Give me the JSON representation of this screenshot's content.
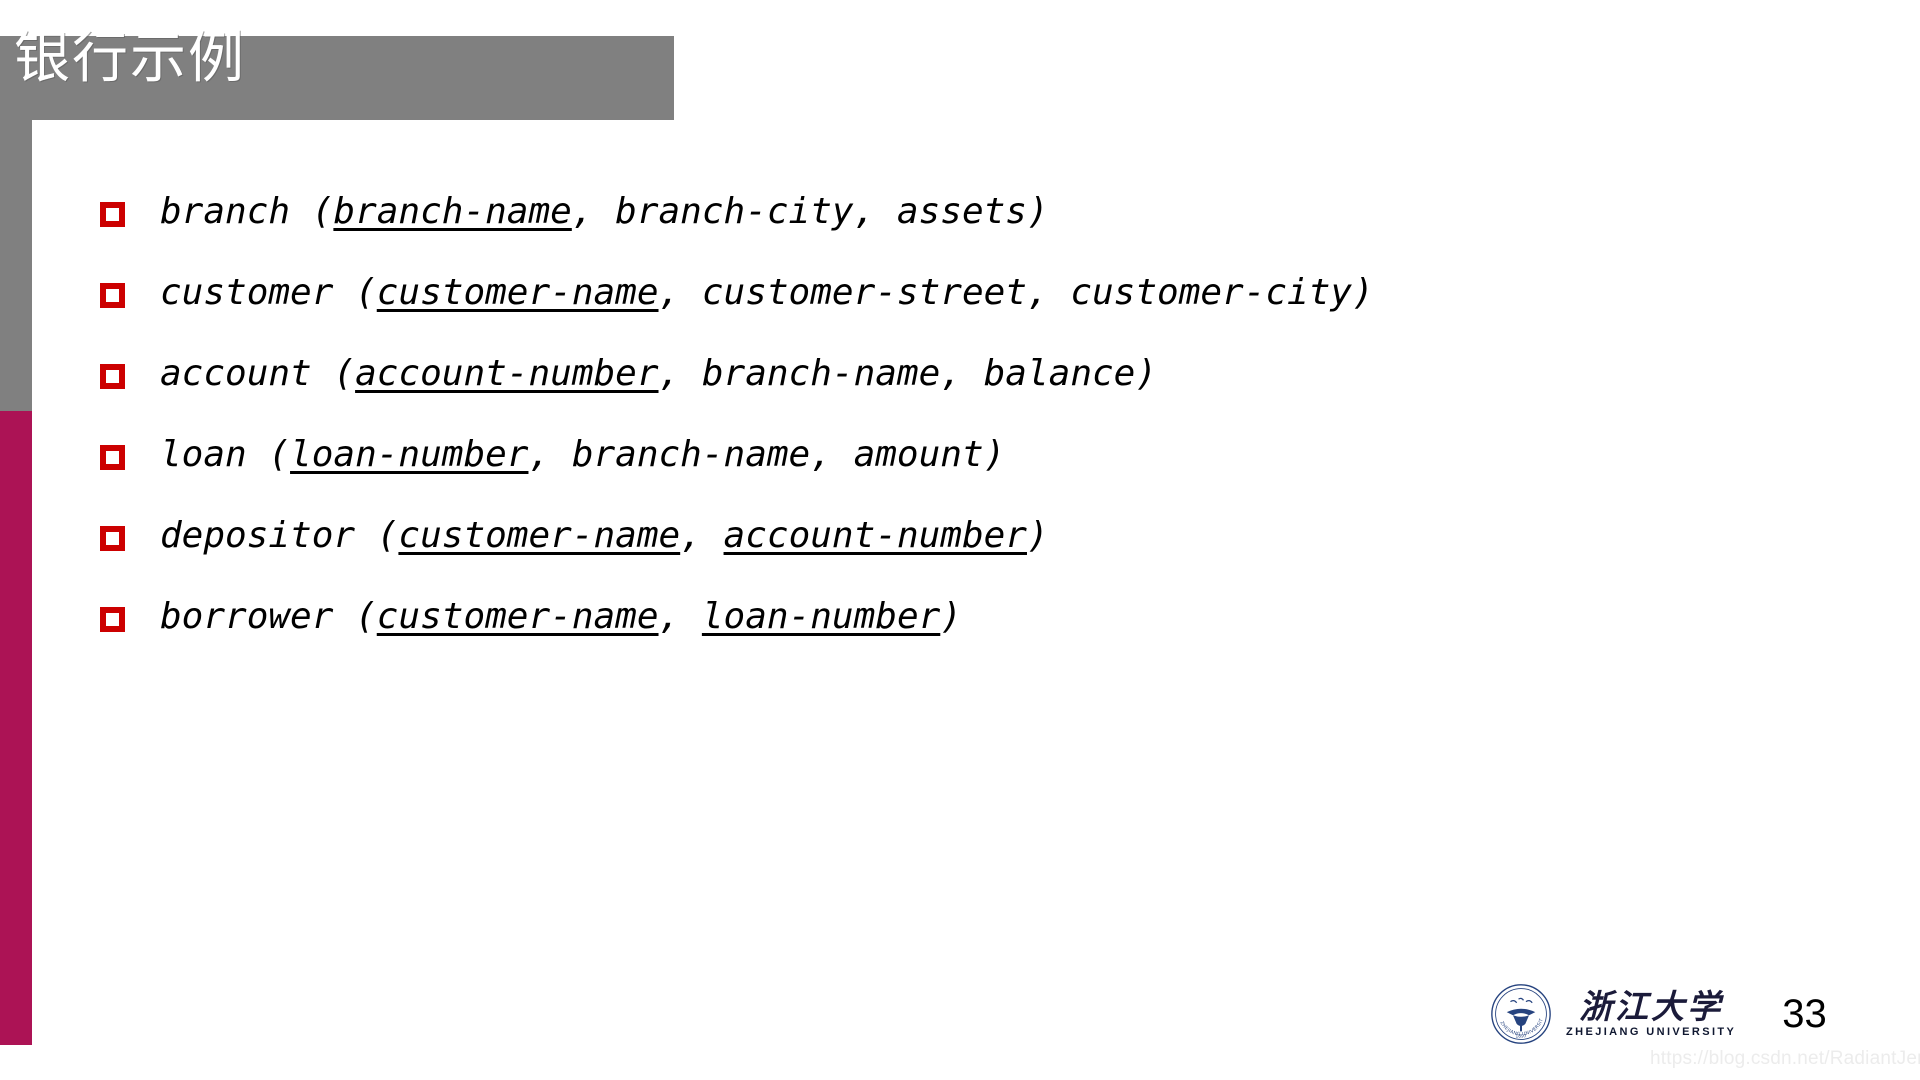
{
  "slide": {
    "title": "银行示例",
    "page_number": "33",
    "colors": {
      "banner_gray": "#808080",
      "accent_crimson": "#ac1355",
      "bullet_red": "#cc0000",
      "title_text": "#ffffff",
      "body_text": "#000000",
      "logo_blue": "#26437f",
      "watermark_gray": "#ececec"
    }
  },
  "bullets": [
    {
      "marker": "red-hollow-square-bullet",
      "relation": "branch",
      "full_text": "branch (branch-name, branch-city, assets)",
      "parts": [
        {
          "text": "branch (",
          "underline": false
        },
        {
          "text": "branch-name",
          "underline": true
        },
        {
          "text": ", branch-city, assets)",
          "underline": false
        }
      ]
    },
    {
      "marker": "red-hollow-square-bullet",
      "relation": "customer",
      "full_text": "customer (customer-name, customer-street, customer-city)",
      "parts": [
        {
          "text": "customer (",
          "underline": false
        },
        {
          "text": "customer-name",
          "underline": true
        },
        {
          "text": ", customer-street, customer-city)",
          "underline": false
        }
      ]
    },
    {
      "marker": "red-hollow-square-bullet",
      "relation": "account",
      "full_text": "account (account-number, branch-name, balance)",
      "parts": [
        {
          "text": "account (",
          "underline": false
        },
        {
          "text": "account-number",
          "underline": true
        },
        {
          "text": ", branch-name, balance)",
          "underline": false
        }
      ]
    },
    {
      "marker": "red-hollow-square-bullet",
      "relation": "loan",
      "full_text": "loan (loan-number, branch-name, amount)",
      "parts": [
        {
          "text": "loan (",
          "underline": false
        },
        {
          "text": "loan-number",
          "underline": true
        },
        {
          "text": ", branch-name, amount)",
          "underline": false
        }
      ]
    },
    {
      "marker": "red-hollow-square-bullet",
      "relation": "depositor",
      "full_text": "depositor (customer-name, account-number)",
      "parts": [
        {
          "text": "depositor (",
          "underline": false
        },
        {
          "text": "customer-name",
          "underline": true
        },
        {
          "text": ", ",
          "underline": false
        },
        {
          "text": "account-number",
          "underline": true
        },
        {
          "text": ")",
          "underline": false
        }
      ]
    },
    {
      "marker": "red-hollow-square-bullet",
      "relation": "borrower",
      "full_text": "borrower (customer-name, loan-number)",
      "parts": [
        {
          "text": "borrower (",
          "underline": false
        },
        {
          "text": "customer-name",
          "underline": true
        },
        {
          "text": ", ",
          "underline": false
        },
        {
          "text": "loan-number",
          "underline": true
        },
        {
          "text": ")",
          "underline": false
        }
      ]
    }
  ],
  "footer": {
    "logo_name": "zhejiang-university-seal-icon",
    "wordmark_cn": "浙江大学",
    "wordmark_en": "ZHEJIANG UNIVERSITY",
    "seal_ring_text": "ZHEJIANG UNIVERSITY",
    "seal_year": "1897"
  },
  "watermark": {
    "text": "https://blog.csdn.net/RadiantJeral"
  }
}
